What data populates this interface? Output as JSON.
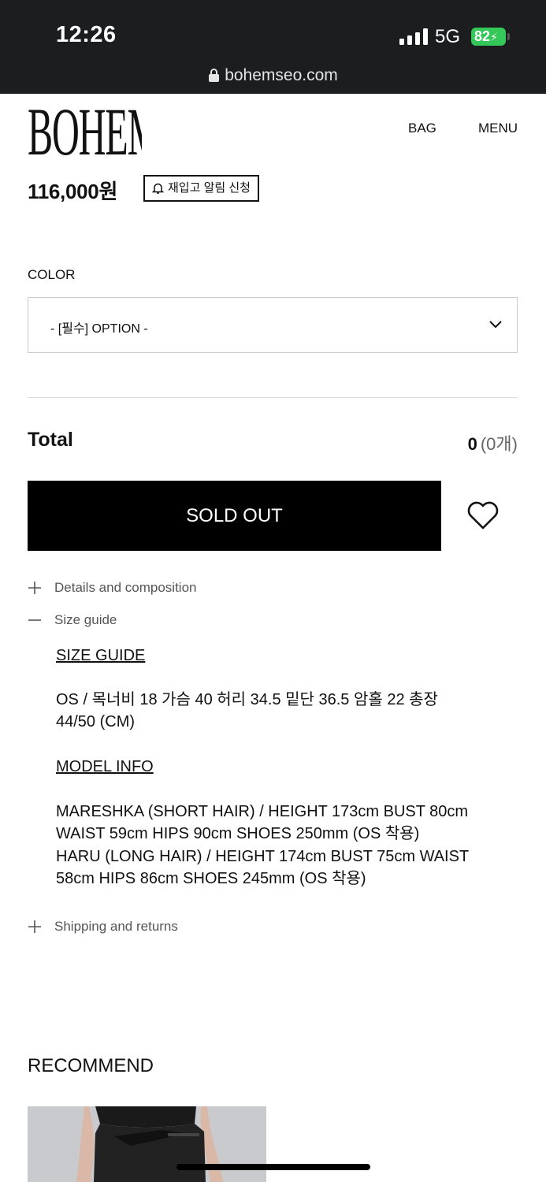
{
  "status": {
    "time": "12:26",
    "network": "5G",
    "battery": "82"
  },
  "browser": {
    "url": "bohemseo.com"
  },
  "header": {
    "logo_text": "BOHEMSEO",
    "bag": "BAG",
    "menu": "MENU"
  },
  "product": {
    "price": "116,000원",
    "restock_label": "재입고 알림 신청"
  },
  "option": {
    "label": "COLOR",
    "selected": "- [필수] OPTION -"
  },
  "total": {
    "label": "Total",
    "amount": "0",
    "count": "(0개)"
  },
  "actions": {
    "sold_out": "SOLD OUT"
  },
  "accordion": {
    "details": "Details and composition",
    "size": "Size guide",
    "shipping": "Shipping and returns"
  },
  "size_guide": {
    "title": "SIZE GUIDE",
    "line1": "OS / 목너비 18 가슴 40 허리 34.5 밑단 36.5 암홀 22 총장",
    "line2": "44/50 (CM)",
    "model_title": "MODEL INFO",
    "model1": "MARESHKA (SHORT HAIR) / HEIGHT 173cm BUST 80cm",
    "model2": "WAIST 59cm HIPS 90cm SHOES 250mm (OS 착용)",
    "model3": "HARU (LONG HAIR) / HEIGHT 174cm BUST 75cm WAIST",
    "model4": "58cm HIPS 86cm SHOES 245mm  (OS 착용)"
  },
  "recommend": {
    "title": "RECOMMEND"
  },
  "icons": [
    "lock-icon",
    "bell-icon",
    "chevron-down-icon",
    "heart-icon",
    "plus-icon",
    "minus-icon",
    "signal-icon"
  ],
  "colors": {
    "topbar": "#1c1d1f",
    "battery": "#34c759",
    "button": "#000000"
  }
}
